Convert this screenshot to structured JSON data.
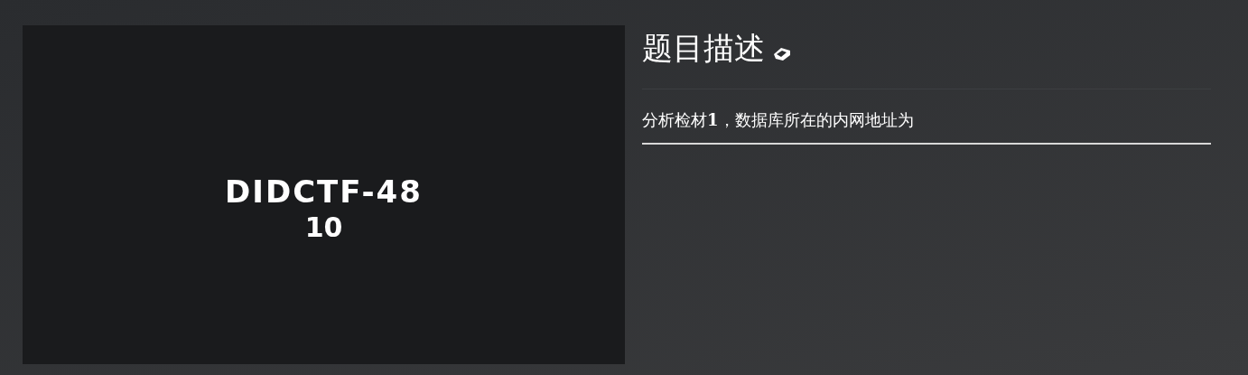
{
  "challenge_card": {
    "title": "DIDCTF-48",
    "points": "10"
  },
  "description": {
    "heading": "题目描述",
    "text": "分析检材**1**，数据库所在的内网地址为"
  }
}
